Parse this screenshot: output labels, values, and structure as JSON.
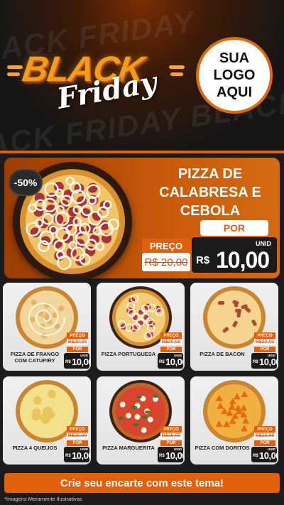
{
  "header": {
    "logo_top": "BLACK",
    "logo_bottom": "Friday",
    "bg_words": [
      "ACK FRIDAY BLACK",
      "FRIDAY BLACK",
      "BLACK FRIDAY"
    ],
    "sua_logo": [
      "SUA",
      "LOGO",
      "AQUI"
    ]
  },
  "featured": {
    "discount": "-50%",
    "title": "PIZZA DE CALABRESA E CEBOLA",
    "preco_label": "PREÇO",
    "old_price": "R$ 20,00",
    "por_label": "POR",
    "unid_label": "UNID",
    "currency": "R$",
    "new_price": "10,00"
  },
  "products": [
    {
      "name": "PIZZA DE FRANGO COM CATUPIRY",
      "preco_label": "PREÇO",
      "old_price": "R$20,00",
      "por_label": "POR",
      "unid_label": "UNID",
      "currency": "R$",
      "new_price": "10,00",
      "topping": "chicken"
    },
    {
      "name": "PIZZA PORTUGUESA",
      "preco_label": "PREÇO",
      "old_price": "R$20,00",
      "por_label": "POR",
      "unid_label": "UNID",
      "currency": "R$",
      "new_price": "10,00",
      "topping": "portuguesa"
    },
    {
      "name": "PIZZA DE BACON",
      "preco_label": "PREÇO",
      "old_price": "R$20,00",
      "por_label": "POR",
      "unid_label": "UNID",
      "currency": "R$",
      "new_price": "10,00",
      "topping": "bacon"
    },
    {
      "name": "PIZZA 4 QUEIJOS",
      "preco_label": "PREÇO",
      "old_price": "R$20,00",
      "por_label": "POR",
      "unid_label": "UNID",
      "currency": "R$",
      "new_price": "10,00",
      "topping": "cheese"
    },
    {
      "name": "PIZZA MARGUERITA",
      "preco_label": "PREÇO",
      "old_price": "R$20,00",
      "por_label": "POR",
      "unid_label": "UNID",
      "currency": "R$",
      "new_price": "10,00",
      "topping": "margherita"
    },
    {
      "name": "PIZZA COM DORITOS",
      "preco_label": "PREÇO",
      "old_price": "R$20,00",
      "por_label": "POR",
      "unid_label": "UNID",
      "currency": "R$",
      "new_price": "10,00",
      "topping": "doritos"
    }
  ],
  "footer": {
    "cta": "Crie seu encarte com este tema!",
    "disclaimer": "*Imagens Meramente Ilustrativas"
  },
  "colors": {
    "accent": "#e2600b",
    "card_bg": "#f0f0f0",
    "price_box": "#1b1b1b"
  }
}
